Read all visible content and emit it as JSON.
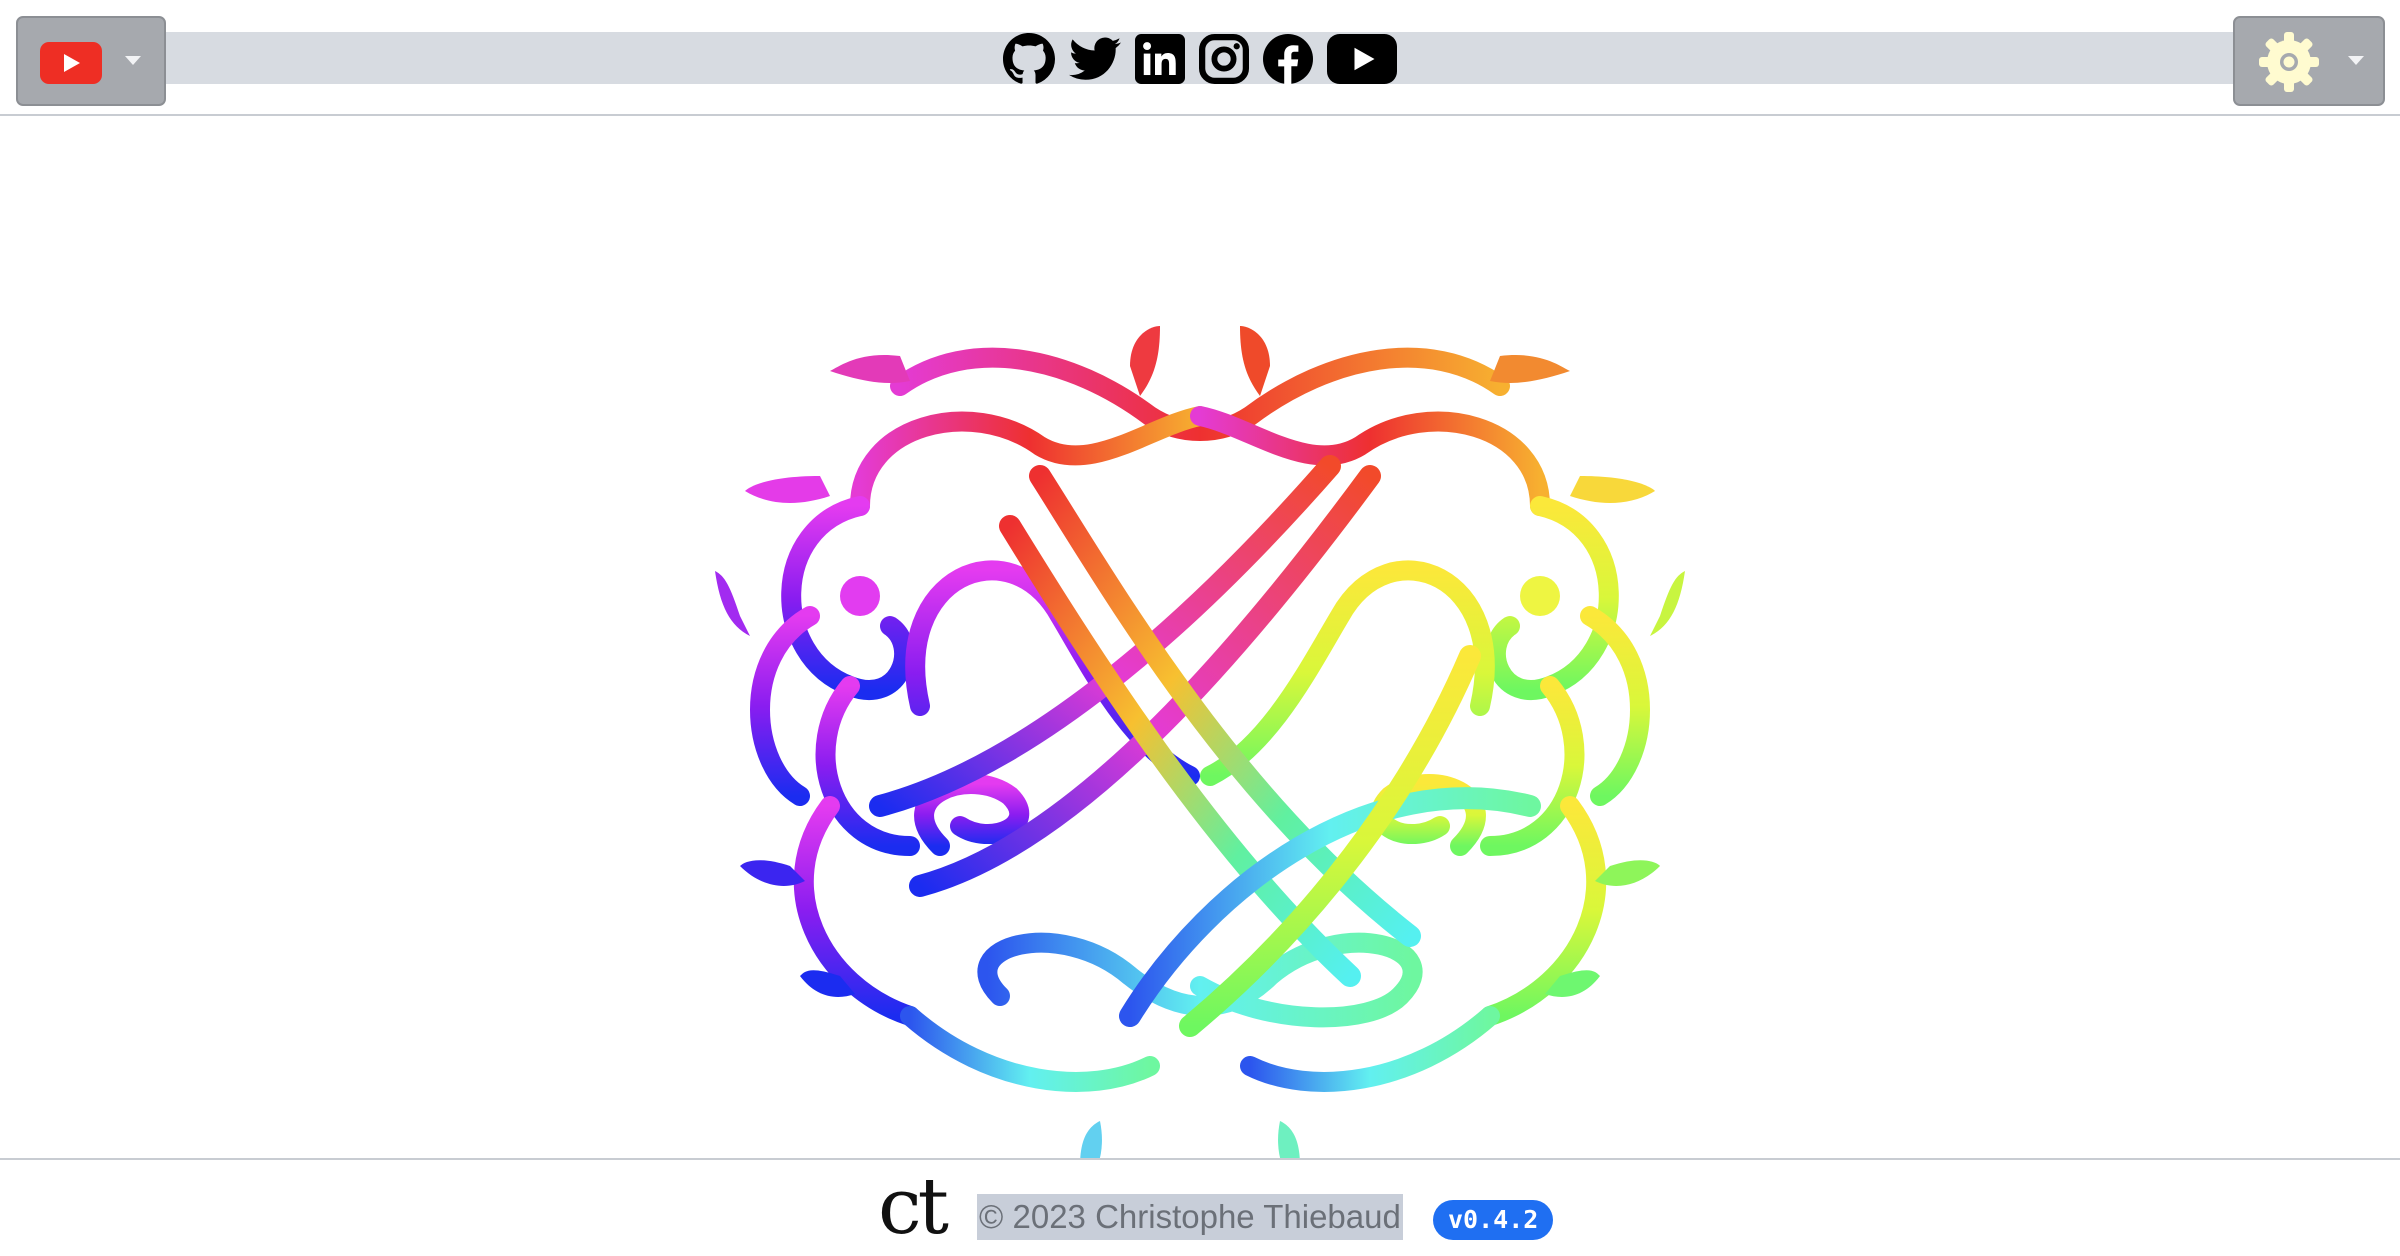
{
  "header": {
    "left_dropdown": {
      "icon": "youtube-icon",
      "caret": "chevron-down-icon"
    },
    "social_links": [
      {
        "name": "github",
        "icon": "github-icon"
      },
      {
        "name": "twitter",
        "icon": "twitter-icon"
      },
      {
        "name": "linkedin",
        "icon": "linkedin-icon"
      },
      {
        "name": "instagram",
        "icon": "instagram-icon"
      },
      {
        "name": "facebook",
        "icon": "facebook-icon"
      },
      {
        "name": "youtube",
        "icon": "youtube-icon"
      }
    ],
    "right_dropdown": {
      "icon": "gear-icon",
      "caret": "chevron-down-icon"
    }
  },
  "main": {
    "image": "rainbow-monogram"
  },
  "footer": {
    "logo_text": "ct",
    "copyright": "© 2023 Christophe Thiebaud",
    "version": "v0.4.2"
  },
  "colors": {
    "header_strip": "#d7dbe1",
    "dropdown_bg": "#a6a9ae",
    "youtube_red": "#ee2e24",
    "gear": "#fffbd0",
    "version_badge": "#1f6ff2",
    "copyright_highlight": "#c8ced9"
  }
}
